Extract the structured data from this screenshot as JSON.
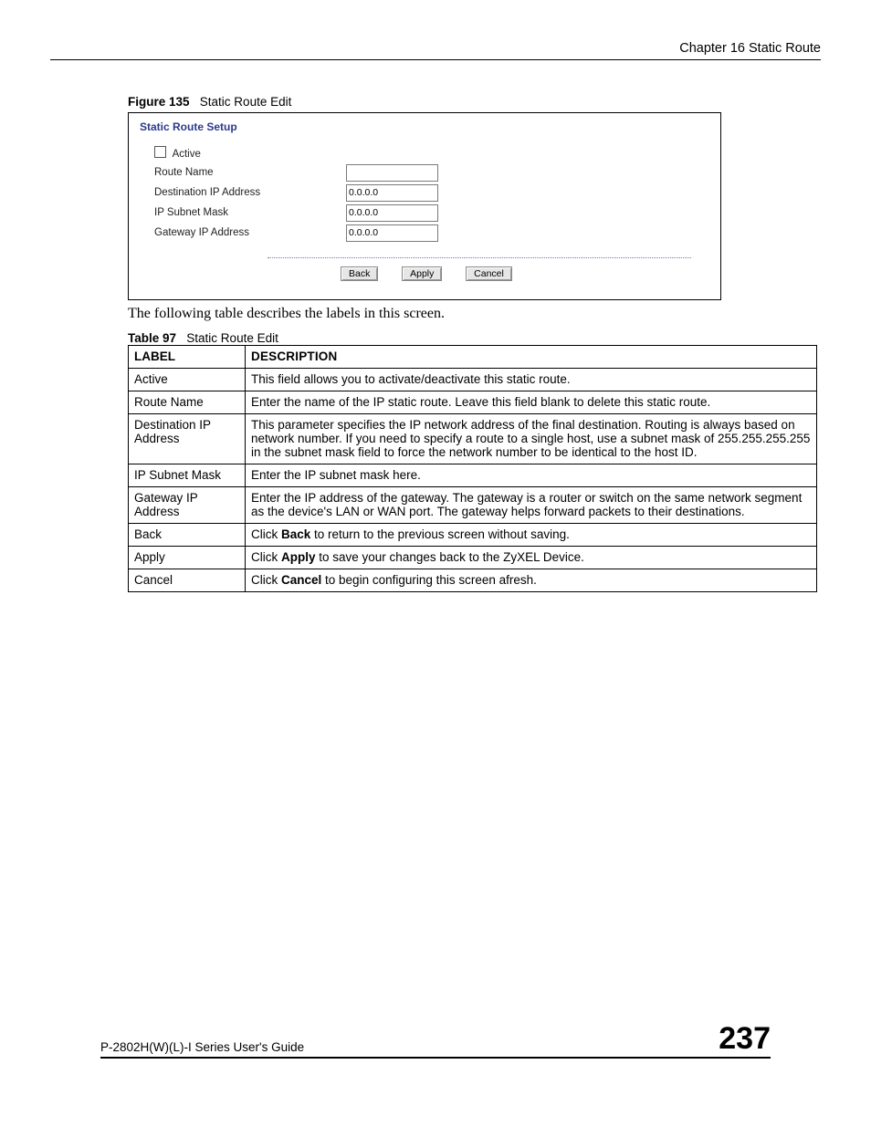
{
  "header": {
    "chapter": "Chapter 16 Static Route"
  },
  "figure": {
    "label": "Figure 135",
    "title": "Static Route Edit"
  },
  "screenshot": {
    "panel_title": "Static Route Setup",
    "active_label": "Active",
    "rows": {
      "route_name": {
        "label": "Route Name",
        "value": ""
      },
      "dest_ip": {
        "label": "Destination IP Address",
        "value": "0.0.0.0"
      },
      "subnet": {
        "label": "IP Subnet Mask",
        "value": "0.0.0.0"
      },
      "gateway": {
        "label": "Gateway IP Address",
        "value": "0.0.0.0"
      }
    },
    "buttons": {
      "back": "Back",
      "apply": "Apply",
      "cancel": "Cancel"
    }
  },
  "intro": "The following table describes the labels in this screen.",
  "table_caption": {
    "label": "Table 97",
    "title": "Static Route Edit"
  },
  "table": {
    "head": {
      "label": "LABEL",
      "desc": "DESCRIPTION"
    },
    "rows": [
      {
        "label": "Active",
        "desc": "This field allows you to activate/deactivate this static route."
      },
      {
        "label": "Route Name",
        "desc": "Enter the name of the IP static route. Leave this field blank to delete this static route."
      },
      {
        "label": "Destination IP Address",
        "desc": "This parameter specifies the IP network address of the final destination. Routing is always based on network number. If you need to specify a route to a single host, use a subnet mask of 255.255.255.255 in the subnet mask field to force the network number to be identical to the host ID."
      },
      {
        "label": "IP Subnet Mask",
        "desc": "Enter the IP subnet mask here."
      },
      {
        "label": "Gateway IP Address",
        "desc": "Enter the IP address of the gateway. The gateway is a router or switch on the same network segment as the device's LAN or WAN port. The gateway helps forward packets to their destinations."
      },
      {
        "label": "Back",
        "desc_pre": "Click ",
        "desc_bold": "Back",
        "desc_post": " to return to the previous screen without saving."
      },
      {
        "label": "Apply",
        "desc_pre": "Click ",
        "desc_bold": "Apply",
        "desc_post": " to save your changes back to the ZyXEL Device."
      },
      {
        "label": "Cancel",
        "desc_pre": "Click ",
        "desc_bold": "Cancel",
        "desc_post": " to begin configuring this screen afresh."
      }
    ]
  },
  "footer": {
    "guide": "P-2802H(W)(L)-I Series User's Guide",
    "page": "237"
  }
}
